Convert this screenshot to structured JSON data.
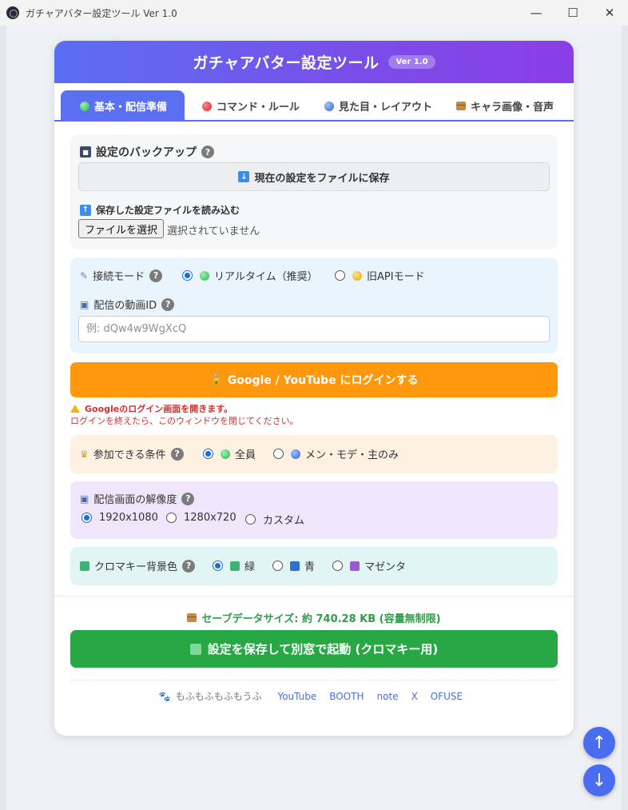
{
  "window": {
    "title": "ガチャアバター設定ツール Ver 1.0",
    "minimize": "—",
    "maximize": "☐",
    "close": "✕"
  },
  "header": {
    "title": "ガチャアバター設定ツール",
    "version": "Ver 1.0"
  },
  "tabs": [
    {
      "label": "基本・配信準備",
      "icon": "green-circle-icon",
      "active": true
    },
    {
      "label": "コマンド・ルール",
      "icon": "red-circle-icon",
      "active": false
    },
    {
      "label": "見た目・レイアウト",
      "icon": "blue-circle-icon",
      "active": false
    },
    {
      "label": "キャラ画像・音声",
      "icon": "package-icon",
      "active": false
    }
  ],
  "backup": {
    "title": "設定のバックアップ",
    "help": "?",
    "save_label": "現在の設定をファイルに保存",
    "load_title": "保存した設定ファイルを読み込む",
    "file_button": "ファイルを選択",
    "file_status": "選択されていません"
  },
  "connection": {
    "mode_label": "接続モード",
    "help": "?",
    "options": [
      {
        "label": "リアルタイム（推奨）",
        "selected": true
      },
      {
        "label": "旧APIモード",
        "selected": false
      }
    ],
    "video_id_label": "配信の動画ID",
    "video_id_placeholder": "例: dQw4w9WgXcQ",
    "video_id_value": ""
  },
  "login": {
    "button": "Google / YouTube にログインする",
    "warning_line1": "Googleのログイン画面を開きます。",
    "warning_line2": "ログインを終えたら、このウィンドウを閉じてください。"
  },
  "condition": {
    "label": "参加できる条件",
    "help": "?",
    "options": [
      {
        "label": "全員",
        "selected": true
      },
      {
        "label": "メン・モデ・主のみ",
        "selected": false
      }
    ]
  },
  "resolution": {
    "label": "配信画面の解像度",
    "help": "?",
    "options": [
      {
        "label": "1920x1080",
        "selected": true
      },
      {
        "label": "1280x720",
        "selected": false
      },
      {
        "label": "カスタム",
        "selected": false
      }
    ]
  },
  "chroma": {
    "label": "クロマキー背景色",
    "help": "?",
    "options": [
      {
        "label": "緑",
        "selected": true,
        "color": "#3cb371"
      },
      {
        "label": "青",
        "selected": false,
        "color": "#2f6fd6"
      },
      {
        "label": "マゼンタ",
        "selected": false,
        "color": "#9b59d6"
      }
    ]
  },
  "save_size": "セーブデータサイズ: 約 740.28 KB (容量無制限)",
  "launch_button": "設定を保存して別窓で起動 (クロマキー用)",
  "footer": {
    "author": "もふもふもふもうふ",
    "links": [
      "YouTube",
      "BOOTH",
      "note",
      "X",
      "OFUSE"
    ]
  },
  "fab": {
    "up": "↑",
    "down": "↓"
  },
  "colors": {
    "accent": "#5b6ff2",
    "login": "#ff980d",
    "launch": "#28a745",
    "warning": "#d32f2f"
  }
}
